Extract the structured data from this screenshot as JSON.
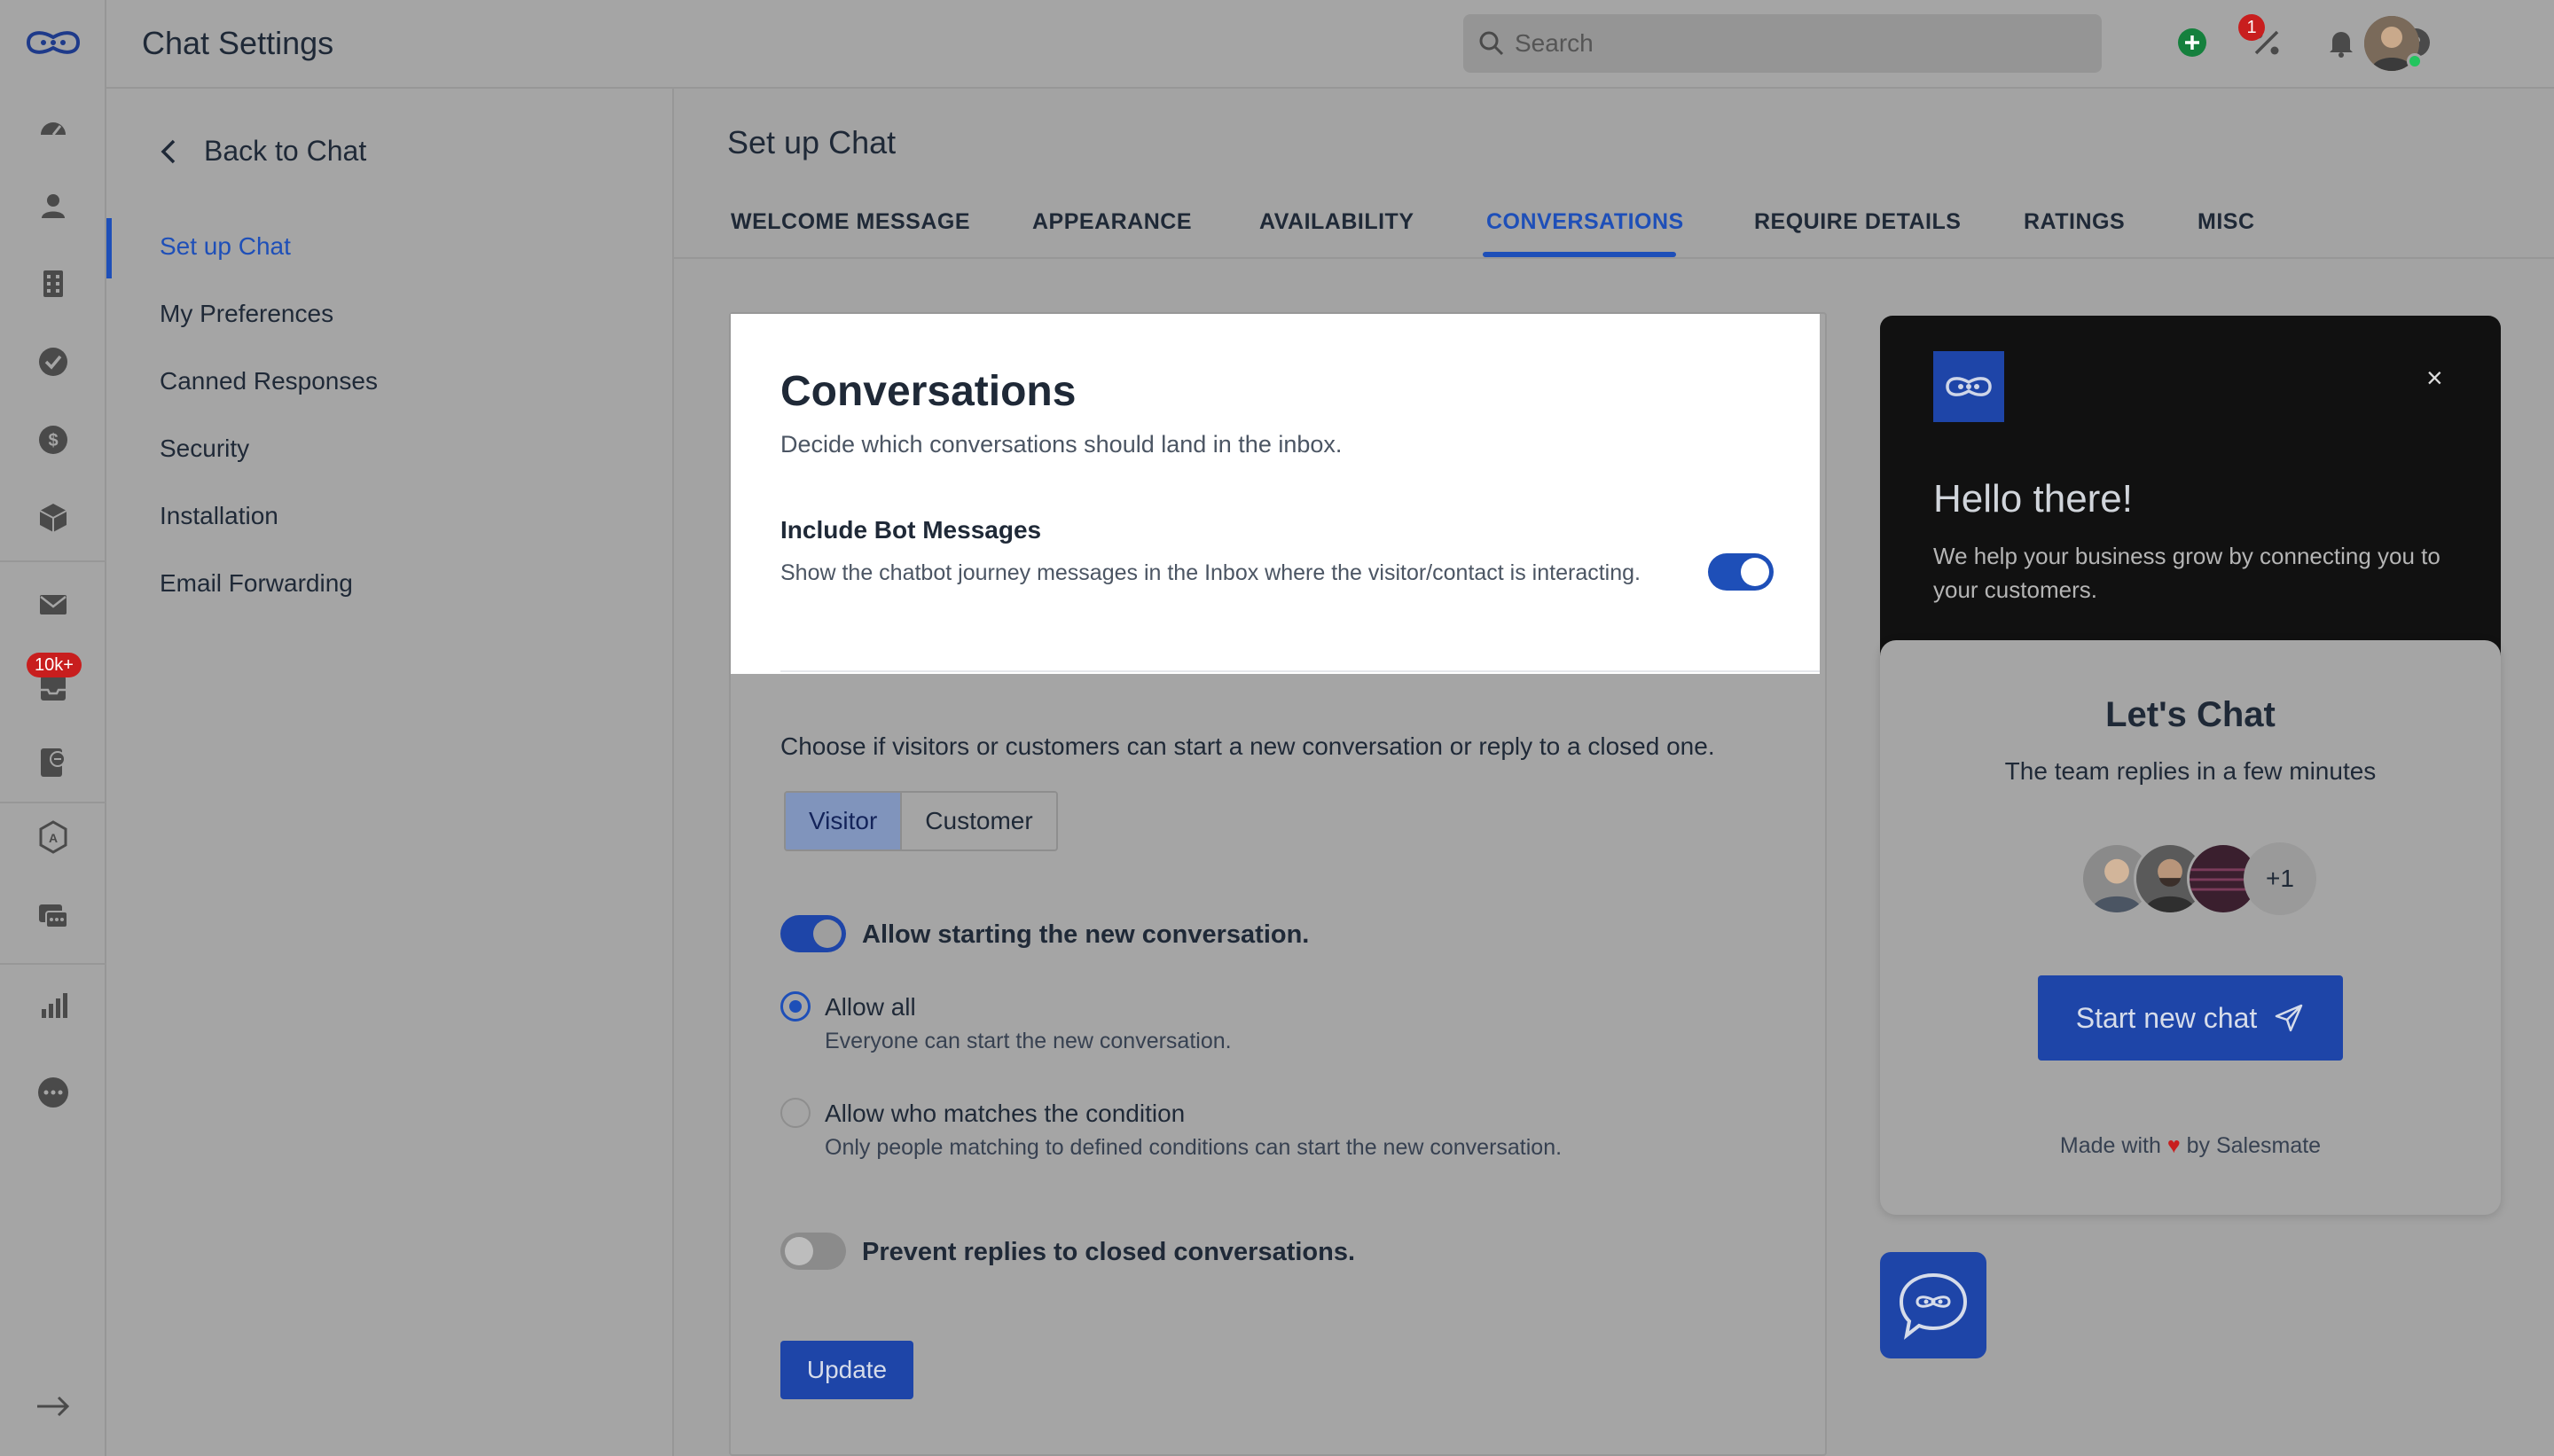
{
  "app": {
    "title": "Chat Settings"
  },
  "rail": {
    "inbox_badge": "10k+"
  },
  "topbar": {
    "search_placeholder": "Search",
    "notification_count": "1"
  },
  "settings_nav": {
    "back_label": "Back to Chat",
    "items": [
      {
        "label": "Set up Chat",
        "active": true
      },
      {
        "label": "My Preferences"
      },
      {
        "label": "Canned Responses"
      },
      {
        "label": "Security"
      },
      {
        "label": "Installation"
      },
      {
        "label": "Email Forwarding"
      }
    ]
  },
  "main": {
    "page_title": "Set up Chat",
    "tabs": [
      {
        "label": "WELCOME MESSAGE"
      },
      {
        "label": "APPEARANCE"
      },
      {
        "label": "AVAILABILITY"
      },
      {
        "label": "CONVERSATIONS",
        "active": true
      },
      {
        "label": "REQUIRE DETAILS"
      },
      {
        "label": "RATINGS"
      },
      {
        "label": "MISC"
      }
    ],
    "section": {
      "title": "Conversations",
      "subtitle": "Decide which conversations should land in the inbox.",
      "bot_messages": {
        "title": "Include Bot Messages",
        "description": "Show the chatbot journey messages in the Inbox where the visitor/contact is interacting.",
        "enabled": true
      },
      "choose_text": "Choose if visitors or customers can start a new conversation or reply to a closed one.",
      "segments": [
        {
          "label": "Visitor",
          "selected": true
        },
        {
          "label": "Customer"
        }
      ],
      "allow_new": {
        "label": "Allow starting the new conversation.",
        "enabled": true
      },
      "radio_options": [
        {
          "label": "Allow all",
          "description": "Everyone can start the new conversation.",
          "selected": true
        },
        {
          "label": "Allow who matches the condition",
          "description": "Only people matching to defined conditions can start the new conversation."
        }
      ],
      "prevent_replies": {
        "label": "Prevent replies to closed conversations.",
        "enabled": false
      },
      "update_label": "Update"
    }
  },
  "widget": {
    "close_symbol": "×",
    "hello": "Hello there!",
    "help_text": "We help your business grow by connecting you to your customers.",
    "lets_chat": "Let's Chat",
    "team_replies": "The team replies in a few minutes",
    "more_agents": "+1",
    "start_label": "Start new chat",
    "made_with": "Made with",
    "by_text": "by Salesmate",
    "heart": "♥"
  },
  "colors": {
    "accent": "#1e4fb8",
    "button": "#1e45a8",
    "badge": "#c81e1e"
  }
}
